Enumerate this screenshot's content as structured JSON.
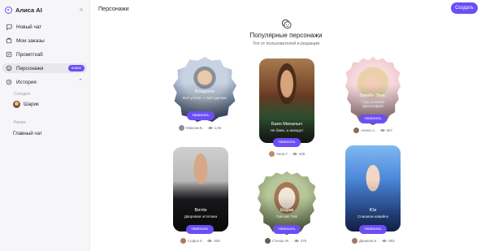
{
  "brand": {
    "name": "Алиса AI",
    "collapse_icon": "double-chevron-left-icon"
  },
  "sidebar": {
    "items": [
      {
        "label": "Новый чат",
        "icon": "new-chat-icon"
      },
      {
        "label": "Мои заказы",
        "icon": "orders-icon"
      },
      {
        "label": "Промптхаб",
        "icon": "prompthub-icon"
      },
      {
        "label": "Персонажи",
        "icon": "characters-icon",
        "badge": "новое",
        "active": true
      },
      {
        "label": "История",
        "icon": "history-icon",
        "expanded": true
      }
    ],
    "history": {
      "today_label": "Сегодня",
      "today_items": [
        {
          "label": "Шарик"
        }
      ],
      "earlier_label": "Ранее",
      "earlier_items": [
        {
          "label": "Главный чат"
        }
      ]
    }
  },
  "header": {
    "title": "Персонажи",
    "create_label": "Создать"
  },
  "hero": {
    "icon": "theater-mask-icon",
    "title": "Популярные персонажи",
    "subtitle": "Топ от пользователей и редакции"
  },
  "cards": [
    {
      "name": "Воздухон",
      "desc": "Всё успею — всё сделаю",
      "button": "Написать",
      "author": "Максим Б.",
      "views": "1,6К"
    },
    {
      "name": "Баян Михалыч",
      "desc": "Не баян, а анекдот",
      "button": "Написать",
      "author": "Анна Г.",
      "views": "63К"
    },
    {
      "name": "Бимбо Элис",
      "desc": "Гуру розовой философии",
      "button": "Написать",
      "author": "Алена А.",
      "views": "667"
    },
    {
      "name": "Витёк",
      "desc": "Дворовая эстетика",
      "button": "Написать",
      "author": "Софья К.",
      "views": "636"
    },
    {
      "name": "Шарик",
      "desc": "Гав-гав! Гав!",
      "button": "Написать",
      "author": "Степан Ж.",
      "views": "476"
    },
    {
      "name": "Юи",
      "desc": "Слишком кавайно",
      "button": "Написать",
      "author": "Даниела К.",
      "views": "593"
    }
  ],
  "colors": {
    "accent": "#6c4ef5",
    "sidebar_bg": "#f6f6f8"
  }
}
